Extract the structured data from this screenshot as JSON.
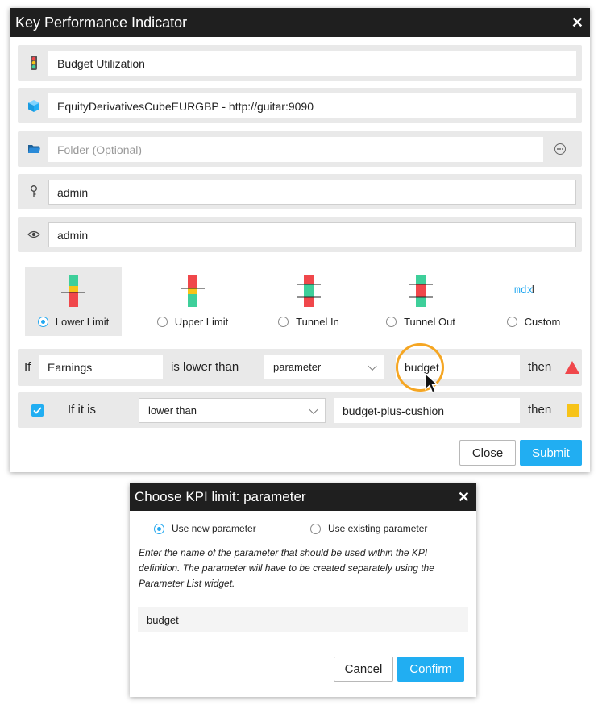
{
  "kpi_dialog": {
    "title": "Key Performance Indicator",
    "close_glyph": "✕",
    "name_value": "Budget Utilization",
    "cube_value": "EquityDerivativesCubeEURGBP - http://guitar:9090",
    "folder_placeholder": "Folder (Optional)",
    "owner_value": "admin",
    "viewer_value": "admin",
    "icons": [
      "traffic-light-icon",
      "cube-icon",
      "folder-icon",
      "key-icon",
      "eye-icon",
      "ellipsis-icon"
    ],
    "kpi_types": [
      {
        "label": "Lower Limit",
        "selected": true
      },
      {
        "label": "Upper Limit",
        "selected": false
      },
      {
        "label": "Tunnel In",
        "selected": false
      },
      {
        "label": "Tunnel Out",
        "selected": false
      },
      {
        "label": "Custom",
        "selected": false
      }
    ],
    "custom_icon_text": "mdx",
    "rule1": {
      "if_label": "If",
      "measure_value": "Earnings",
      "comparison_text": "is lower than",
      "limit_type": "parameter",
      "parameter_value": "budget",
      "then_label": "then",
      "status_icon": "red-triangle-icon"
    },
    "rule2": {
      "checked": true,
      "if_it_is_label": "If it is",
      "comparison_select": "lower than",
      "parameter_value": "budget-plus-cushion",
      "then_label": "then",
      "status_icon": "yellow-square-icon"
    },
    "close_button": "Close",
    "submit_button": "Submit"
  },
  "param_dialog": {
    "title": "Choose KPI limit: parameter",
    "close_glyph": "✕",
    "option_new": "Use new parameter",
    "option_existing": "Use existing parameter",
    "selected_option": "new",
    "description": "Enter the name of the parameter that should be used within the KPI definition. The parameter will have to be created separately using the Parameter List widget.",
    "parameter_value": "budget",
    "cancel_button": "Cancel",
    "confirm_button": "Confirm"
  },
  "colors": {
    "accent": "#21aef2",
    "red": "#f0474b",
    "green": "#3ecf9a",
    "yellow": "#f7c318",
    "highlight_ring": "#f5a623",
    "titlebar": "#1f1f1f"
  }
}
